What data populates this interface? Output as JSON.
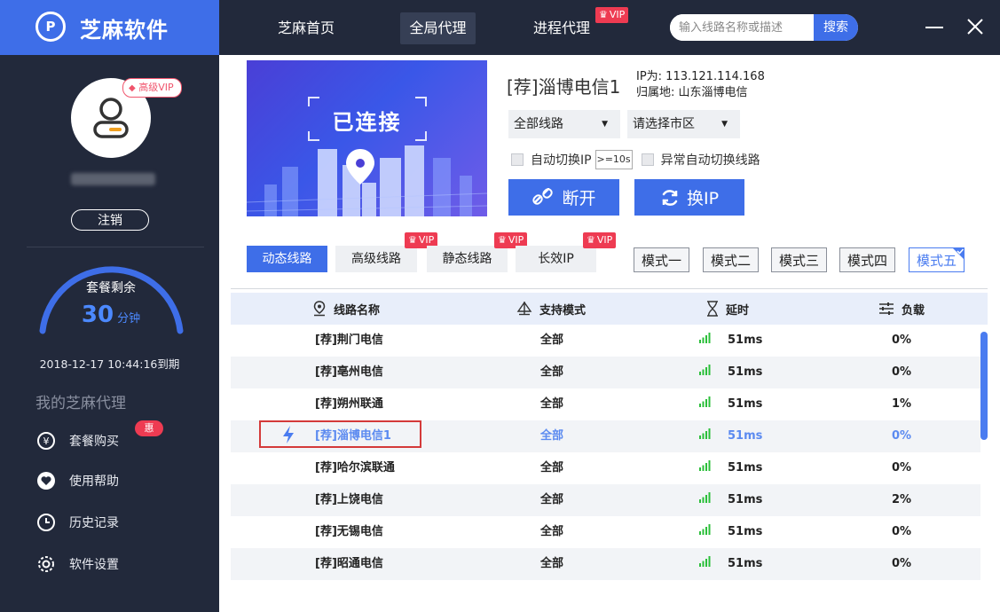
{
  "app": {
    "name": "芝麻软件",
    "logo_text": "P"
  },
  "colors": {
    "accent": "#3e6ee8",
    "sidebar_bg": "#22293b",
    "vip_red": "#ee3b52",
    "selected_text": "#5b8af0",
    "signal_green": "#2bbf3a"
  },
  "sidebar": {
    "vip_badge": "高级VIP",
    "logout_label": "注销",
    "package_label": "套餐剩余",
    "remaining_value": "30",
    "remaining_unit": "分钟",
    "expire_text": "2018-12-17  10:44:16到期",
    "section_title": "我的芝麻代理",
    "menu": [
      {
        "label": "套餐购买",
        "icon": "yen-coin-icon"
      },
      {
        "label": "使用帮助",
        "icon": "heart-icon"
      },
      {
        "label": "历史记录",
        "icon": "clock-icon"
      },
      {
        "label": "软件设置",
        "icon": "gear-icon"
      }
    ],
    "menu_badge": "惠"
  },
  "nav": {
    "items": [
      {
        "label": "芝麻首页"
      },
      {
        "label": "全局代理"
      },
      {
        "label": "进程代理"
      }
    ],
    "vip_label": "VIP",
    "search_placeholder": "输入线路名称或描述",
    "search_button": "搜索"
  },
  "connection": {
    "status": "已连接",
    "server_name": "[荐]淄博电信1",
    "ip_text": "IP为: 113.121.114.168",
    "location_text": "归属地: 山东淄博电信",
    "line_select": "全部线路",
    "city_select": "请选择市区",
    "auto_switch_label": "自动切换IP",
    "interval_value": ">=10s",
    "abnormal_switch_label": "异常自动切换线路",
    "disconnect_label": "断开",
    "change_ip_label": "换IP"
  },
  "line_tabs": [
    {
      "label": "动态线路",
      "vip": false
    },
    {
      "label": "高级线路",
      "vip": true
    },
    {
      "label": "静态线路",
      "vip": true
    },
    {
      "label": "长效IP",
      "vip": true
    }
  ],
  "modes": [
    "模式一",
    "模式二",
    "模式三",
    "模式四",
    "模式五"
  ],
  "table": {
    "headers": {
      "name": "线路名称",
      "mode": "支持模式",
      "latency": "延时",
      "load": "负载"
    },
    "rows": [
      {
        "name": "[荐]荆门电信",
        "mode": "全部",
        "latency": "51ms",
        "load": "0%"
      },
      {
        "name": "[荐]亳州电信",
        "mode": "全部",
        "latency": "51ms",
        "load": "0%"
      },
      {
        "name": "[荐]朔州联通",
        "mode": "全部",
        "latency": "51ms",
        "load": "1%"
      },
      {
        "name": "[荐]淄博电信1",
        "mode": "全部",
        "latency": "51ms",
        "load": "0%"
      },
      {
        "name": "[荐]哈尔滨联通",
        "mode": "全部",
        "latency": "51ms",
        "load": "0%"
      },
      {
        "name": "[荐]上饶电信",
        "mode": "全部",
        "latency": "51ms",
        "load": "2%"
      },
      {
        "name": "[荐]无锡电信",
        "mode": "全部",
        "latency": "51ms",
        "load": "0%"
      },
      {
        "name": "[荐]昭通电信",
        "mode": "全部",
        "latency": "51ms",
        "load": "0%"
      }
    ],
    "selected_index": 3
  }
}
